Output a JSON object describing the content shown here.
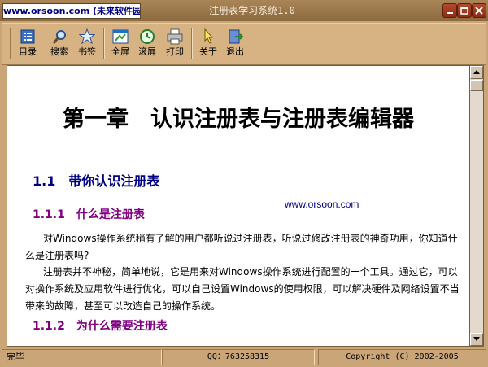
{
  "window": {
    "site_badge": "www.orsoon.com (未来软件园)",
    "title": "注册表学习系统1.0"
  },
  "toolbar": {
    "buttons": [
      {
        "label": "目录",
        "icon": "contents-icon"
      },
      {
        "label": "搜索",
        "icon": "search-icon"
      },
      {
        "label": "书签",
        "icon": "bookmark-icon"
      },
      {
        "label": "全屏",
        "icon": "fullscreen-icon"
      },
      {
        "label": "滚屏",
        "icon": "autoscroll-icon"
      },
      {
        "label": "打印",
        "icon": "printer-icon"
      },
      {
        "label": "关于",
        "icon": "about-icon"
      },
      {
        "label": "退出",
        "icon": "exit-icon"
      }
    ]
  },
  "document": {
    "chapter_title": "第一章　认识注册表与注册表编辑器",
    "section_heading": "1.1　带你认识注册表",
    "watermark": "www.orsoon.com",
    "sub1_heading": "1.1.1　什么是注册表",
    "para1": "对Windows操作系统稍有了解的用户都听说过注册表，听说过修改注册表的神奇功用，你知道什么是注册表吗?",
    "para2": "注册表并不神秘，简单地说，它是用来对Windows操作系统进行配置的一个工具。通过它，可以对操作系统及应用软件进行优化，可以自己设置Windows的使用权限，可以解决硬件及网络设置不当带来的故障，甚至可以改造自己的操作系统。",
    "sub2_heading": "1.1.2　为什么需要注册表"
  },
  "statusbar": {
    "status": "完毕",
    "qq": "QQ：763258315",
    "copyright": "Copyright (C) 2002-2005"
  },
  "colors": {
    "frame": "#c9a577",
    "toolbar": "#d7b384",
    "section_heading": "#000080",
    "sub_heading": "#800080"
  }
}
